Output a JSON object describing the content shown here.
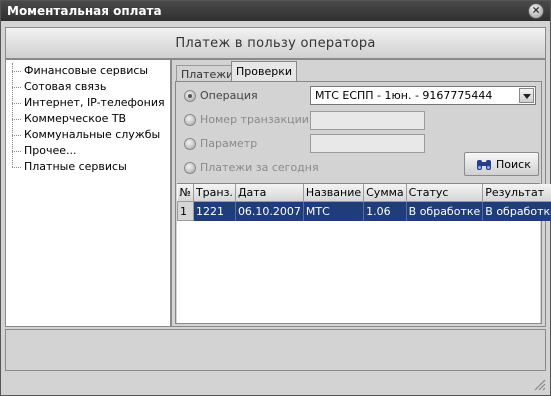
{
  "window": {
    "title": "Моментальная оплата",
    "close_glyph": "×"
  },
  "header": {
    "title": "Платеж в пользу оператора"
  },
  "sidebar": {
    "items": [
      {
        "label": "Финансовые сервисы"
      },
      {
        "label": "Сотовая связь"
      },
      {
        "label": "Интернет, IP-телефония"
      },
      {
        "label": "Коммерческое ТВ"
      },
      {
        "label": "Коммунальные службы"
      },
      {
        "label": "Прочее..."
      },
      {
        "label": "Платные сервисы"
      }
    ]
  },
  "tabs": {
    "payments": "Платежи",
    "checks": "Проверки",
    "active": "checks"
  },
  "filters": {
    "operation_label": "Операция",
    "operation_value": "МТС ЕСПП - 1юн. - 9167775444",
    "transaction_label": "Номер транзакции",
    "transaction_value": "",
    "parameter_label": "Параметр",
    "parameter_value": "",
    "today_label": "Платежи за сегодня",
    "selected": "operation"
  },
  "search": {
    "label": "Поиск",
    "icon": "binoculars-icon"
  },
  "table": {
    "columns": [
      "№",
      "Транз.",
      "Дата",
      "Название",
      "Сумма",
      "Статус",
      "Результат"
    ],
    "rows": [
      [
        "1",
        "1221",
        "06.10.2007",
        "МТС",
        "1.06",
        "В обработке",
        "В обработке"
      ]
    ]
  },
  "colors": {
    "selection": "#1f3d7a",
    "titlebar": "#3a3a3a"
  }
}
